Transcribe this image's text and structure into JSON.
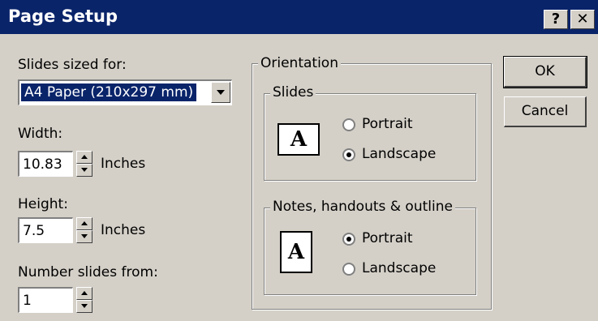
{
  "window": {
    "title": "Page Setup",
    "help_label": "?",
    "close_label": "✕"
  },
  "slides_sized_for": {
    "label": "Slides sized for:",
    "value": "A4 Paper (210x297 mm)"
  },
  "width": {
    "label": "Width:",
    "value": "10.83",
    "unit": "Inches"
  },
  "height": {
    "label": "Height:",
    "value": "7.5",
    "unit": "Inches"
  },
  "number_slides_from": {
    "label": "Number slides from:",
    "value": "1"
  },
  "orientation": {
    "label": "Orientation",
    "slides": {
      "label": "Slides",
      "portrait": "Portrait",
      "landscape": "Landscape",
      "selected": "landscape"
    },
    "notes": {
      "label": "Notes, handouts & outline",
      "portrait": "Portrait",
      "landscape": "Landscape",
      "selected": "portrait"
    }
  },
  "buttons": {
    "ok": "OK",
    "cancel": "Cancel"
  },
  "icon_glyph": "A"
}
